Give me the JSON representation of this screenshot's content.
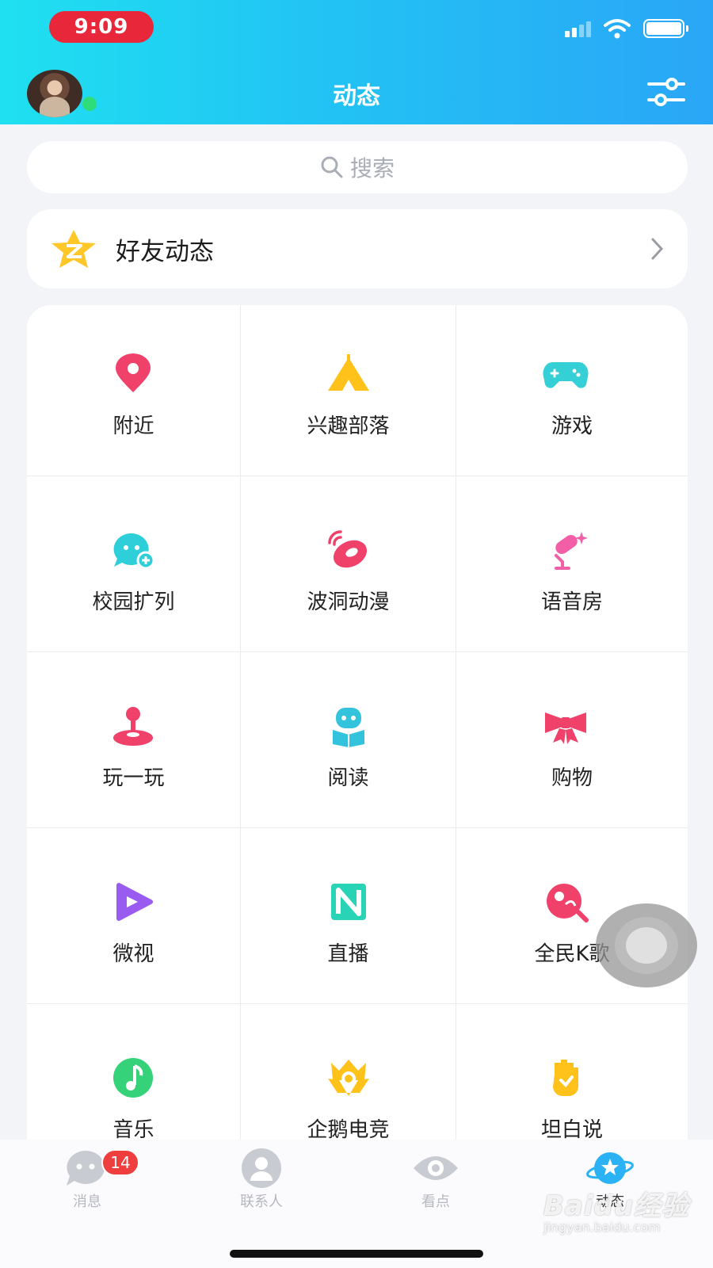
{
  "status_bar": {
    "time": "9:09"
  },
  "header": {
    "title": "动态"
  },
  "search": {
    "placeholder": "搜索"
  },
  "friend_feed": {
    "label": "好友动态"
  },
  "grid": {
    "items": [
      {
        "label": "附近",
        "icon": "location-pin-icon",
        "color": "#f0416a"
      },
      {
        "label": "兴趣部落",
        "icon": "tent-icon",
        "color": "#ffc21a"
      },
      {
        "label": "游戏",
        "icon": "gamepad-icon",
        "color": "#35d0d6"
      },
      {
        "label": "校园扩列",
        "icon": "chat-face-add-icon",
        "color": "#2fcfd9"
      },
      {
        "label": "波洞动漫",
        "icon": "planet-signal-icon",
        "color": "#f0416a"
      },
      {
        "label": "语音房",
        "icon": "microphone-icon",
        "color": "#f25fa7"
      },
      {
        "label": "玩一玩",
        "icon": "joystick-icon",
        "color": "#f0416a"
      },
      {
        "label": "阅读",
        "icon": "robot-book-icon",
        "color": "#33c3dd"
      },
      {
        "label": "购物",
        "icon": "bow-icon",
        "color": "#f0416a"
      },
      {
        "label": "微视",
        "icon": "play-icon",
        "color": "#9a5cf0"
      },
      {
        "label": "直播",
        "icon": "live-n-icon",
        "color": "#29d3b5"
      },
      {
        "label": "全民K歌",
        "icon": "karaoke-icon",
        "color": "#f0416a"
      },
      {
        "label": "音乐",
        "icon": "music-note-icon",
        "color": "#36d279"
      },
      {
        "label": "企鹅电竞",
        "icon": "crown-penguin-icon",
        "color": "#ffc21a"
      },
      {
        "label": "坦白说",
        "icon": "hand-icon",
        "color": "#ffc21a"
      }
    ]
  },
  "tabbar": {
    "messages": {
      "label": "消息",
      "badge": "14"
    },
    "contacts": {
      "label": "联系人"
    },
    "watch": {
      "label": "看点"
    },
    "moments": {
      "label": "动态"
    }
  },
  "watermark": {
    "brand": "Baidu经验",
    "url": "jingyan.baidu.com"
  }
}
